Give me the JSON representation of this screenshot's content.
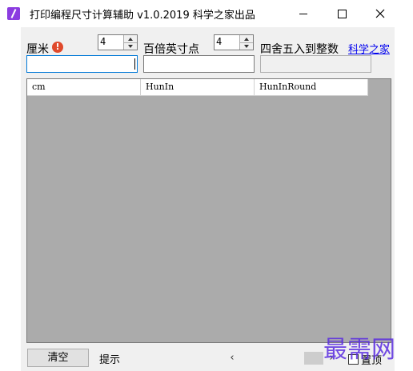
{
  "window": {
    "title": "打印编程尺寸计算辅助  v1.0.2019  科学之家出品"
  },
  "form": {
    "cm_label": "厘米",
    "cm_value": "",
    "cm_decimals": "4",
    "inch_points_label": "百倍英寸点",
    "inch_points_value": "",
    "inch_decimals": "4",
    "round_label": "四舍五入到整数",
    "round_value": "",
    "link_label": "科学之家"
  },
  "grid": {
    "columns": [
      "cm",
      "HunIn",
      "HunInRound"
    ]
  },
  "footer": {
    "clear_label": "清空",
    "hint_label": "提示",
    "topmost_label": "置顶",
    "topmost_checked": false
  },
  "watermark": {
    "text": "最需网"
  }
}
